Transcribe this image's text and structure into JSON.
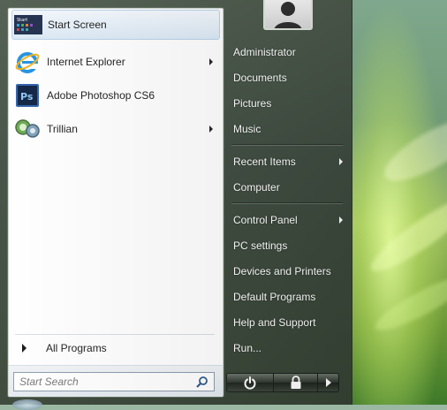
{
  "left_pane": {
    "pinned": [
      {
        "label": "Start Screen",
        "icon": "start-screen-icon",
        "has_arrow": false
      },
      {
        "label": "Internet Explorer",
        "icon": "internet-explorer-icon",
        "has_arrow": true
      },
      {
        "label": "Adobe Photoshop CS6",
        "icon": "photoshop-icon",
        "has_arrow": false
      },
      {
        "label": "Trillian",
        "icon": "trillian-icon",
        "has_arrow": true
      }
    ],
    "start_tile_text": "Start",
    "photoshop_glyph": "Ps",
    "all_programs": "All Programs",
    "search_placeholder": "Start Search"
  },
  "right_pane": {
    "items": [
      {
        "label": "Administrator",
        "has_arrow": false
      },
      {
        "label": "Documents",
        "has_arrow": false
      },
      {
        "label": "Pictures",
        "has_arrow": false
      },
      {
        "label": "Music",
        "has_arrow": false
      },
      {
        "label": "Recent Items",
        "has_arrow": true
      },
      {
        "label": "Computer",
        "has_arrow": false
      },
      {
        "label": "Control Panel",
        "has_arrow": true
      },
      {
        "label": "PC settings",
        "has_arrow": false
      },
      {
        "label": "Devices and Printers",
        "has_arrow": false
      },
      {
        "label": "Default Programs",
        "has_arrow": false
      },
      {
        "label": "Help and Support",
        "has_arrow": false
      },
      {
        "label": "Run...",
        "has_arrow": false
      }
    ]
  },
  "power": {
    "buttons": [
      "power-icon",
      "lock-icon",
      "arrow-right-icon"
    ]
  },
  "colors": {
    "highlight": "#dbe9f6",
    "menu_dark": "#3f4c40",
    "ie_blue": "#1e8fe0",
    "ps_blue": "#2b5ea8"
  }
}
